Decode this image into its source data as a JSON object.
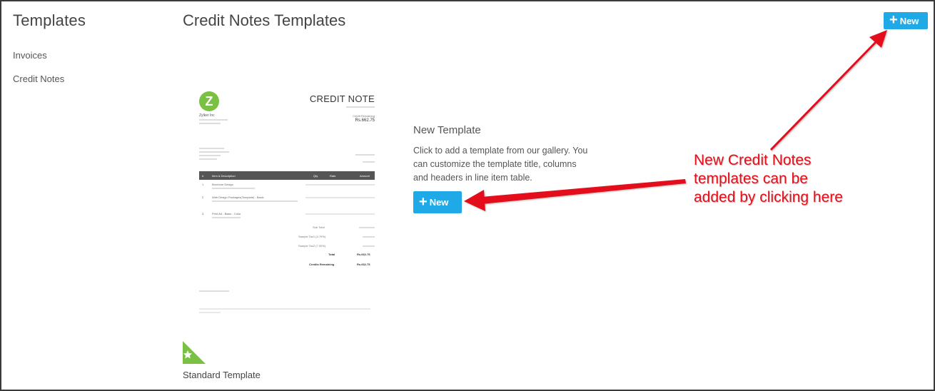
{
  "sidebar": {
    "title": "Templates",
    "items": [
      {
        "label": "Invoices"
      },
      {
        "label": "Credit Notes"
      }
    ]
  },
  "header": {
    "title": "Credit Notes Templates",
    "new_label": "New"
  },
  "preview": {
    "logo_letter": "Z",
    "org_name": "Zylker Inc",
    "doc_title": "CREDIT NOTE",
    "remaining_label": "Credit Remaining",
    "remaining_value": "Rs.662.75",
    "table_headers": [
      "#",
      "Item & Description",
      "Qty",
      "Rate",
      "Amount"
    ],
    "rows": [
      {
        "num": "1",
        "name": "Brochure Design"
      },
      {
        "num": "2",
        "name": "Web Design Packages(Template) - Basic"
      },
      {
        "num": "3",
        "name": "Print Ad - Basic - Color"
      }
    ],
    "totals": [
      {
        "label": "Sub Total",
        "value": ""
      },
      {
        "label": "Sample Tax1 (4.70%)",
        "value": ""
      },
      {
        "label": "Sample Tax2 (7.00%)",
        "value": ""
      },
      {
        "label": "Total",
        "value": "Rs.662.75",
        "bold": true
      },
      {
        "label": "Credits Remaining",
        "value": "Rs.662.75",
        "bold": true
      }
    ]
  },
  "new_template": {
    "title": "New Template",
    "description": "Click to add a template from our gallery. You can customize the template title, columns and headers in line item table.",
    "button_label": "New"
  },
  "standard_template": {
    "label": "Standard Template",
    "badge_color": "#7ac143"
  },
  "annotation": {
    "text_line1": "New Credit Notes",
    "text_line2": "templates can be",
    "text_line3": "added by clicking here",
    "color": "#e3111b"
  },
  "colors": {
    "accent": "#1fa9e6",
    "brand_green": "#7ac143",
    "table_header": "#555555"
  }
}
